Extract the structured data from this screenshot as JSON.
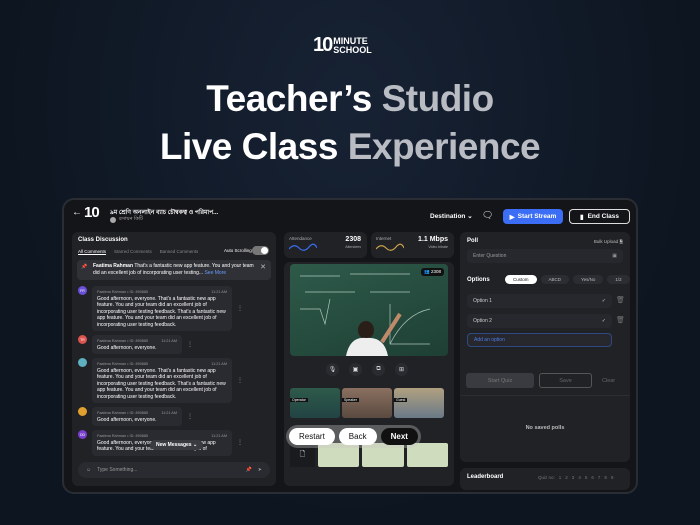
{
  "brand": {
    "logo_num": "10",
    "logo_line1": "MINUTE",
    "logo_line2": "SCHOOL"
  },
  "hero": {
    "line1a": "Teacher’s ",
    "line1b": "Studio",
    "line2a": "Live Class ",
    "line2b": "Experience"
  },
  "header": {
    "course_title": "৯ম শ্রেণি অনলাইন ব্যাচ চৌম্বকত্ব ও পরিমাপ...",
    "subject": "রসায়ন কিটি",
    "destination": "Destination",
    "start_stream": "Start Stream",
    "end_class": "End Class"
  },
  "discussion": {
    "title": "Class Discussion",
    "tabs": [
      "All Comments",
      "Starred Comments",
      "Banned Comments"
    ],
    "auto_scroll": "Auto Scrolling",
    "pinned": {
      "name": "Faatima Rahman",
      "text": "That's a fantastic new app feature. You and your team did an excellent job of incorporating user testing...",
      "see_more": "See More"
    },
    "messages": [
      {
        "initials": "FR",
        "color": "#6a4fd8",
        "meta": "Faatima Rahman • ID: 890885",
        "time": "11:21 AM",
        "text": "Good afternoon, everyone. That's a fantastic new app feature. You and your team did an excellent job of incorporating user testing feedback. That's a fantastic new app feature. You and your team did an excellent job of incorporating user testing feedback."
      },
      {
        "initials": "TR",
        "color": "#d9534f",
        "meta": "Faatima Rahman • ID: 890885",
        "time": "11:21 AM",
        "text": "Good afternoon, everyone."
      },
      {
        "initials": "",
        "color": "#5fb0c0",
        "meta": "Faatima Rahman • ID: 890885",
        "time": "11:21 AM",
        "text": "Good afternoon, everyone. That's a fantastic new app feature. You and your team did an excellent job of incorporating user testing feedback. That's a fantastic new app feature. You and your team did an excellent job of incorporating user testing feedback."
      },
      {
        "initials": "",
        "color": "#e0a030",
        "meta": "Faatima Rahman • ID: 890885",
        "time": "11:21 AM",
        "text": "Good afternoon, everyone."
      },
      {
        "initials": "DD",
        "color": "#7b3fd0",
        "meta": "Faatima Rahman • ID: 890885",
        "time": "11:21 AM",
        "text": "Good afternoon, everyone. That's a fantastic new app feature. You and your team did an excellent job of"
      }
    ],
    "new_messages": "New Messages",
    "input_placeholder": "Type Something..."
  },
  "stats": {
    "attendance_label": "Attendance",
    "attendance_value": "2308",
    "attendance_sub": "Attendees",
    "internet_label": "Internet",
    "internet_value": "1.1 Mbps",
    "internet_sub": "Video bitrate"
  },
  "video": {
    "viewers": "2308",
    "thumbs": [
      "Operator",
      "Speaker",
      "Guest"
    ]
  },
  "controls": {
    "restart": "Restart",
    "back": "Back",
    "next": "Next"
  },
  "poll": {
    "title": "Poll",
    "bulk_upload": "Bulk Upload",
    "question_placeholder": "Enter Question",
    "options_label": "Options",
    "option_types": [
      "Custom",
      "ABCD",
      "Yes/No",
      "1/2"
    ],
    "options": [
      "Option 1",
      "Option 2"
    ],
    "add_option": "Add an option",
    "start_quiz": "Start Quiz",
    "save": "Save",
    "clear": "Clear",
    "empty": "No saved polls"
  },
  "leaderboard": {
    "title": "Leaderboard",
    "quiz_no": "Quiz no:",
    "numbers": [
      "1",
      "2",
      "3",
      "4",
      "5",
      "6",
      "7",
      "8",
      "9"
    ]
  },
  "colors": {
    "accent": "#3b6ef5",
    "bg": "#0f1722"
  }
}
